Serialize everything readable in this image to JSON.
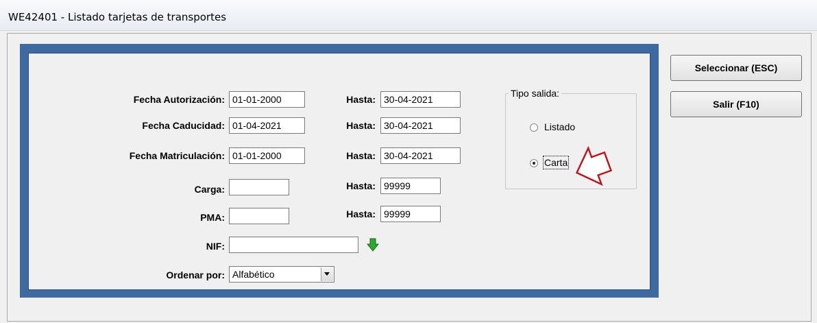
{
  "window": {
    "title": "WE42401 - Listado tarjetas de transportes"
  },
  "form": {
    "fecha_autorizacion": {
      "label": "Fecha Autorización:",
      "desde": "01-01-2000",
      "hasta_label": "Hasta:",
      "hasta": "30-04-2021"
    },
    "fecha_caducidad": {
      "label": "Fecha Caducidad:",
      "desde": "01-04-2021",
      "hasta_label": "Hasta:",
      "hasta": "30-04-2021"
    },
    "fecha_matriculacion": {
      "label": "Fecha Matriculación:",
      "desde": "01-01-2000",
      "hasta_label": "Hasta:",
      "hasta": "30-04-2021"
    },
    "carga": {
      "label": "Carga:",
      "desde": "",
      "hasta_label": "Hasta:",
      "hasta": "99999"
    },
    "pma": {
      "label": "PMA:",
      "desde": "",
      "hasta_label": "Hasta:",
      "hasta": "99999"
    },
    "nif": {
      "label": "NIF:",
      "value": "",
      "icon": "green-down-arrow-icon"
    },
    "ordenar": {
      "label": "Ordenar por:",
      "selected": "Alfabético"
    }
  },
  "tipo_salida": {
    "legend": "Tipo salida:",
    "options": [
      {
        "label": "Listado",
        "selected": false
      },
      {
        "label": "Carta",
        "selected": true
      }
    ]
  },
  "buttons": {
    "seleccionar": "Seleccionar (ESC)",
    "salir": "Salir (F10)"
  },
  "colors": {
    "frame": "#3f6aa1",
    "annotation_arrow": "#c0141c",
    "nif_arrow": "#2ea82e"
  }
}
